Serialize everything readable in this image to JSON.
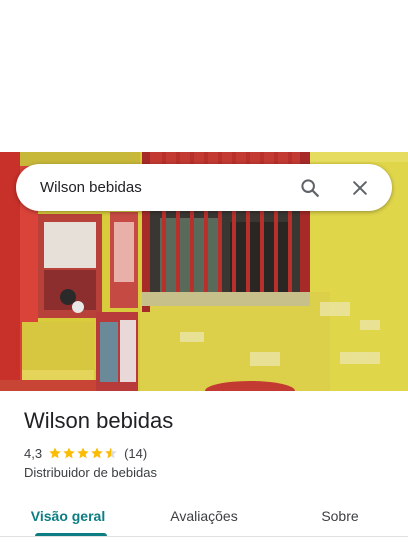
{
  "search": {
    "value": "Wilson bebidas",
    "search_icon": "search-icon",
    "close_icon": "close-icon"
  },
  "place": {
    "name": "Wilson bebidas",
    "rating": "4,3",
    "rating_stars": 4.3,
    "reviews_count": "(14)",
    "category": "Distribuidor de bebidas"
  },
  "tabs": [
    {
      "label": "Visão geral",
      "active": true
    },
    {
      "label": "Avaliações",
      "active": false
    },
    {
      "label": "Sobre",
      "active": false
    }
  ],
  "colors": {
    "accent": "#0b7d83",
    "star": "#fbbc04",
    "star_empty": "#dadce0"
  }
}
